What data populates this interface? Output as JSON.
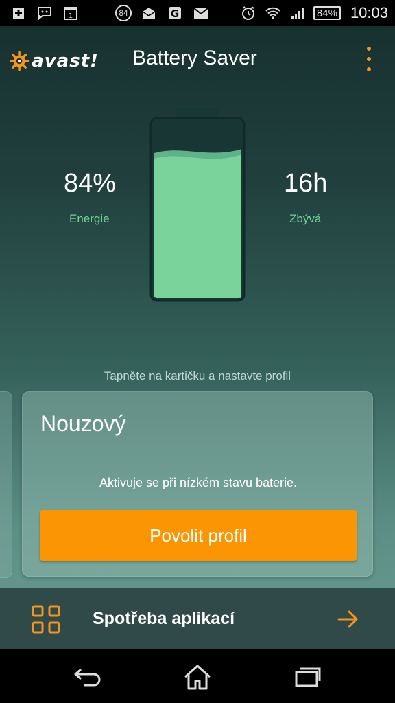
{
  "status_bar": {
    "notification_count": "84",
    "battery_percent": "84%",
    "time": "10:03",
    "calendar_day": "1",
    "icons": [
      "plus-icon",
      "chat-icon",
      "calendar-icon",
      "count-badge",
      "mail-open-icon",
      "g-icon",
      "gmail-icon",
      "alarm-icon",
      "wifi-icon",
      "signal-icon",
      "battery-icon"
    ]
  },
  "app_bar": {
    "logo_text": "avast!",
    "title": "Battery Saver",
    "menu_icon": "overflow-menu-icon"
  },
  "battery": {
    "level": 0.84,
    "energy_value": "84%",
    "energy_label": "Energie",
    "remaining_value": "16h",
    "remaining_label": "Zbývá"
  },
  "hint_text": "Tapněte na kartičku a nastavte profil",
  "profile_card": {
    "title": "Nouzový",
    "description": "Aktivuje se při nízkém stavu baterie.",
    "button_label": "Povolit profil"
  },
  "bottom_bar": {
    "label": "Spotřeba aplikací",
    "icon": "grid-icon",
    "arrow": "arrow-right-icon"
  },
  "colors": {
    "accent": "#fb9504",
    "battery_fill": "#7ad39b",
    "stat_label": "#6fd19a"
  }
}
